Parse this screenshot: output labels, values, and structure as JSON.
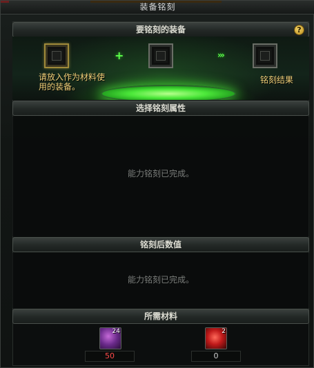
{
  "window": {
    "title": "装备铭刻"
  },
  "engrave": {
    "header": "要铭刻的装备",
    "help": "?",
    "hint": "请放入作为材料使用的装备。",
    "plus": "+",
    "arrow": "›››",
    "result_label": "铭刻结果"
  },
  "attributes": {
    "header": "选择铭刻属性",
    "empty": "能力铭刻已完成。"
  },
  "after_values": {
    "header": "铭刻后数值",
    "empty": "能力铭刻已完成。"
  },
  "materials": {
    "header": "所需材料",
    "items": [
      {
        "icon": "purple-crystal-icon",
        "count": "24",
        "required": "50",
        "color": "#ff4a4a"
      },
      {
        "icon": "red-crystal-icon",
        "count": "2",
        "required": "0",
        "color": "#cfcfcf"
      }
    ]
  }
}
